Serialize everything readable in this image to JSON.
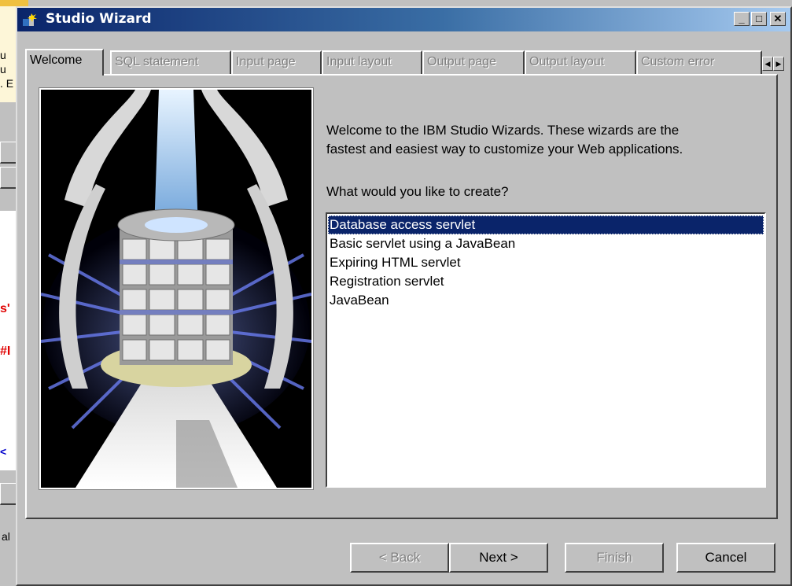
{
  "background_app": {
    "fragments": [
      "u",
      "u",
      ". E",
      "s'",
      "#I",
      "<",
      "al"
    ]
  },
  "window": {
    "title": "Studio Wizard",
    "controls": {
      "minimize": "_",
      "maximize": "□",
      "close": "✕"
    }
  },
  "tabs": [
    {
      "label": "Welcome",
      "enabled": true
    },
    {
      "label": "SQL statement",
      "enabled": false
    },
    {
      "label": "Input page",
      "enabled": false
    },
    {
      "label": "Input layout",
      "enabled": false
    },
    {
      "label": "Output page",
      "enabled": false
    },
    {
      "label": "Output layout",
      "enabled": false
    },
    {
      "label": "Custom error",
      "enabled": false
    }
  ],
  "tab_scroll": {
    "left": "◀",
    "right": "▶"
  },
  "welcome": {
    "intro_line1": "Welcome to the IBM Studio Wizards.  These wizards are the",
    "intro_line2": "fastest and easiest way to customize your Web applications.",
    "question": "What would you like to create?",
    "options": [
      "Database access servlet",
      "Basic servlet using a JavaBean",
      "Expiring HTML servlet",
      "Registration servlet",
      "JavaBean"
    ],
    "selected_index": 0
  },
  "buttons": {
    "back": "< Back",
    "next": "Next >",
    "finish": "Finish",
    "cancel": "Cancel"
  },
  "colors": {
    "title_start": "#0a246a",
    "title_end": "#a6caf0",
    "selection": "#0a246a",
    "face": "#c0c0c0"
  }
}
